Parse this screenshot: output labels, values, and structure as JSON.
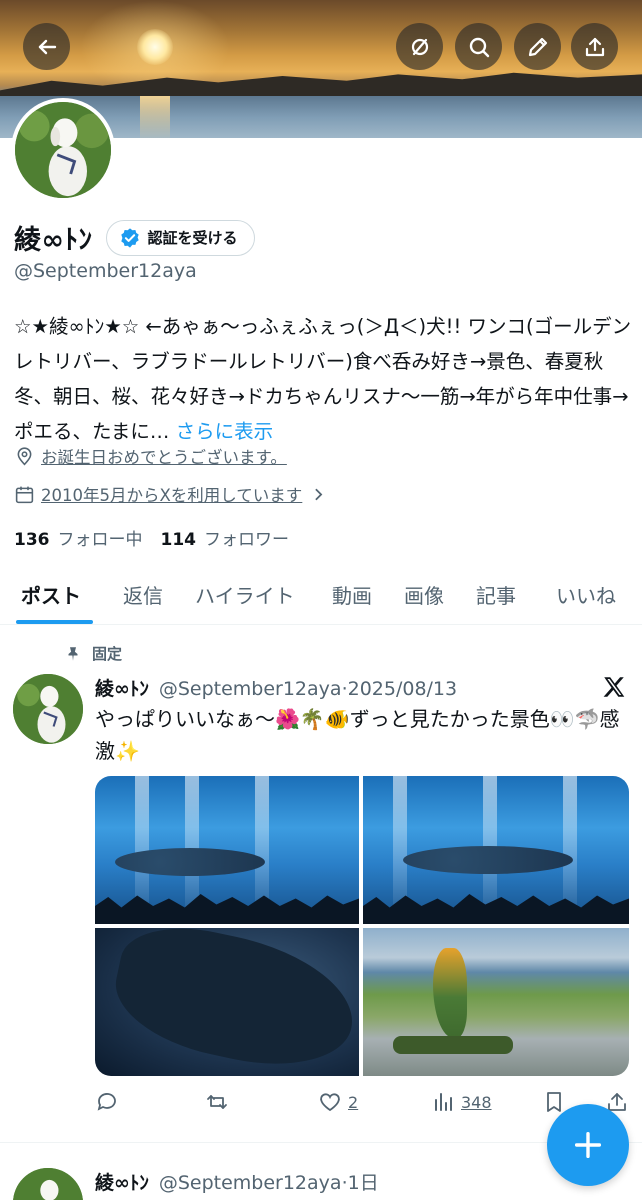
{
  "header": {
    "back_icon": "arrow-left-icon",
    "actions": [
      "mute-icon",
      "search-icon",
      "edit-icon",
      "share-icon"
    ]
  },
  "profile": {
    "display_name": "綾∞ﾄﾝ",
    "verify_label": "認証を受ける",
    "handle": "@September12aya",
    "bio": "☆★綾∞ﾄﾝ★☆ ←あゃぁ〜っふぇふぇっ(＞Д＜)犬!! ワンコ(ゴールデンレトリバー、ラブラドールレトリバー)食べ呑み好き→景色、春夏秋冬、朝日、桜、花々好き→ドカちゃんリスナ〜一筋→年がら年中仕事→ポエる、たまに…",
    "bio_more": "さらに表示",
    "location": "お誕生日おめでとうございます。",
    "joined": "2010年5月からXを利用しています",
    "following_count": "136",
    "following_label": "フォロー中",
    "followers_count": "114",
    "followers_label": "フォロワー"
  },
  "tabs": [
    "ポスト",
    "返信",
    "ハイライト",
    "動画",
    "画像",
    "記事",
    "いいね"
  ],
  "pinned_label": "固定",
  "post": {
    "name": "綾∞ﾄﾝ",
    "handle": "@September12aya",
    "date": "·2025/08/13",
    "text": "やっぱりいいなぁ〜🌺🌴🐠ずっと見たかった景色👀🦈感激✨",
    "replies": "",
    "reposts": "",
    "likes": "2",
    "views": "348"
  },
  "next_post": {
    "name": "綾∞ﾄﾝ",
    "handle": "@September12aya",
    "date": "·1日"
  },
  "colors": {
    "accent": "#1d9bf0",
    "text": "#0f1419",
    "muted": "#536471"
  }
}
